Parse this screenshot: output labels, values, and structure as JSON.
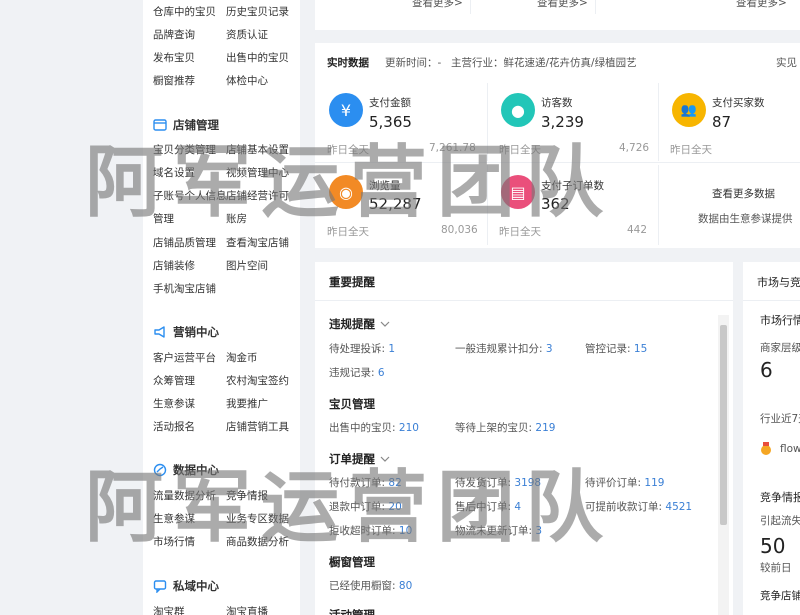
{
  "sidebar": {
    "top_links": [
      [
        "仓库中的宝贝",
        "历史宝贝记录"
      ],
      [
        "品牌查询",
        "资质认证"
      ],
      [
        "发布宝贝",
        "出售中的宝贝"
      ],
      [
        "橱窗推荐",
        "体检中心"
      ]
    ],
    "sections": [
      {
        "title": "店铺管理",
        "icon": "store-icon",
        "links": [
          [
            "宝贝分类管理",
            "店铺基本设置"
          ],
          [
            "域名设置",
            "视频管理中心"
          ],
          [
            "子账号个人信息",
            "店铺经营许可"
          ],
          [
            "管理",
            "账房"
          ],
          [
            "店铺品质管理",
            "查看淘宝店铺"
          ],
          [
            "店铺装修",
            "图片空间"
          ],
          [
            "手机淘宝店铺",
            ""
          ]
        ]
      },
      {
        "title": "营销中心",
        "icon": "megaphone-icon",
        "links": [
          [
            "客户运营平台",
            "淘金币"
          ],
          [
            "众筹管理",
            "农村淘宝签约"
          ],
          [
            "生意参谋",
            "我要推广"
          ],
          [
            "活动报名",
            "店铺营销工具"
          ]
        ]
      },
      {
        "title": "数据中心",
        "icon": "chart-icon",
        "links": [
          [
            "流量数据分析",
            "竞争情报"
          ],
          [
            "生意参谋",
            "业务专区数据"
          ],
          [
            "市场行情",
            "商品数据分析"
          ]
        ]
      },
      {
        "title": "私域中心",
        "icon": "chat-icon",
        "links": [
          [
            "淘宝群",
            "淘宝直播"
          ]
        ]
      }
    ]
  },
  "top_cards": {
    "more_label": "查看更多>"
  },
  "realtime": {
    "title": "实时数据",
    "update_label": "更新时间：-",
    "industry_label": "主营行业：鲜花速递/花卉仿真/绿植园艺",
    "link": "实见",
    "kpis": [
      {
        "label": "支付金额",
        "value": "5,365",
        "sub_label": "昨日全天",
        "sub_value": "7,261.78",
        "icon": "yen-icon",
        "color": "#2b8ef0",
        "glyph": "¥"
      },
      {
        "label": "访客数",
        "value": "3,239",
        "sub_label": "昨日全天",
        "sub_value": "4,726",
        "icon": "footprint-icon",
        "color": "#22c6b8",
        "glyph": "●"
      },
      {
        "label": "支付买家数",
        "value": "87",
        "sub_label": "昨日全天",
        "sub_value": "",
        "icon": "users-icon",
        "color": "#f7b500",
        "glyph": "👥"
      },
      {
        "label": "浏览量",
        "value": "52,287",
        "sub_label": "昨日全天",
        "sub_value": "80,036",
        "icon": "eye-icon",
        "color": "#f28a25",
        "glyph": "◉"
      },
      {
        "label": "支付子订单数",
        "value": "362",
        "sub_label": "昨日全天",
        "sub_value": "442",
        "icon": "order-icon",
        "color": "#ea4f7b",
        "glyph": "▤"
      }
    ],
    "more_title": "查看更多数据",
    "more_desc": "数据由生意参谋提供"
  },
  "reminders": {
    "title": "重要提醒",
    "violation": {
      "title": "违规提醒",
      "items": [
        {
          "label": "待处理投诉:",
          "value": "1"
        },
        {
          "label": "一般违规累计扣分:",
          "value": "3"
        },
        {
          "label": "管控记录:",
          "value": "15"
        },
        {
          "label": "违规记录:",
          "value": "6"
        }
      ]
    },
    "goods": {
      "title": "宝贝管理",
      "items": [
        {
          "label": "出售中的宝贝:",
          "value": "210"
        },
        {
          "label": "等待上架的宝贝:",
          "value": "219"
        }
      ]
    },
    "orders": {
      "title": "订单提醒",
      "items": [
        {
          "label": "待付款订单:",
          "value": "82"
        },
        {
          "label": "待发货订单:",
          "value": "3198"
        },
        {
          "label": "待评价订单:",
          "value": "119"
        },
        {
          "label": "退款中订单:",
          "value": "20"
        },
        {
          "label": "售后中订单:",
          "value": "4"
        },
        {
          "label": "可提前收款订单:",
          "value": "4521"
        },
        {
          "label": "拒收超时订单:",
          "value": "10"
        },
        {
          "label": "物流未更新订单:",
          "value": "3"
        }
      ]
    },
    "window": {
      "title": "橱窗管理",
      "items": [
        {
          "label": "已经使用橱窗:",
          "value": "80"
        }
      ]
    },
    "activity_title": "活动管理"
  },
  "market": {
    "title": "市场与竞",
    "row1": "市场行情",
    "row2": "商家层级",
    "row2_value": "6",
    "row3": "行业近7天",
    "row4": "flow",
    "row5": "竞争情报",
    "row6": "引起流失",
    "row6_value": "50",
    "row7": "较前日",
    "row8": "竞争店铺"
  },
  "watermark": "阿军运营团队"
}
